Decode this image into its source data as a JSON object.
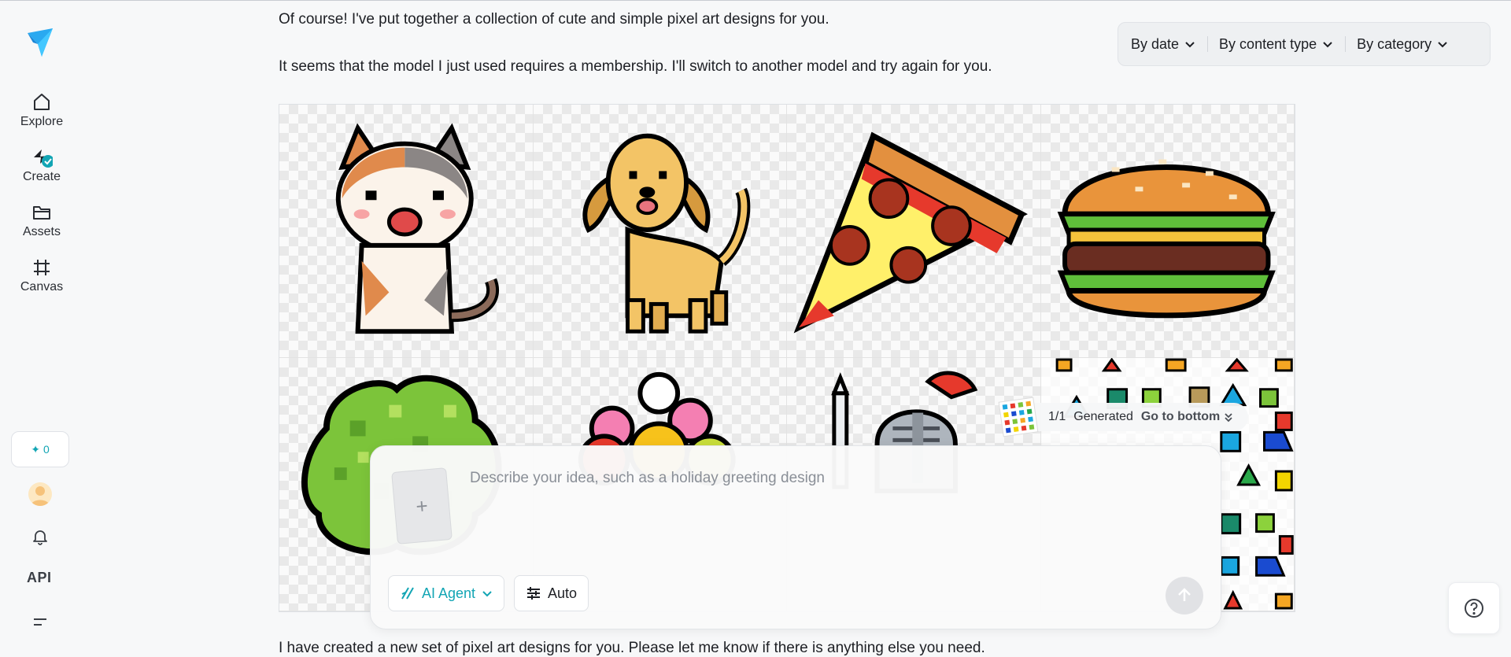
{
  "nav": {
    "items": [
      {
        "label": "Explore",
        "icon": "home-icon"
      },
      {
        "label": "Create",
        "icon": "create-icon"
      },
      {
        "label": "Assets",
        "icon": "folder-icon"
      },
      {
        "label": "Canvas",
        "icon": "canvas-frame-icon"
      }
    ],
    "credits": "0",
    "api_label": "API"
  },
  "messages": {
    "first": "Of course! I've put together a collection of cute and simple pixel art designs for you.",
    "second": "It seems that the model I just used requires a membership. I'll switch to another model and try again for you.",
    "final": "I have created a new set of pixel art designs for you. Please let me know if there is anything else you need."
  },
  "filters": {
    "date": "By date",
    "content_type": "By content type",
    "category": "By category"
  },
  "grid": {
    "tiles": [
      "cat",
      "dog",
      "pizza",
      "burger",
      "bush",
      "flower",
      "knight",
      "shapes"
    ]
  },
  "generation": {
    "count": "1/1",
    "status": "Generated",
    "go_bottom": "Go to bottom"
  },
  "prompt": {
    "placeholder": "Describe your idea, such as a holiday greeting design",
    "upload_icon": "+",
    "agent_label": "AI Agent",
    "auto_label": "Auto"
  },
  "colors": {
    "accent": "#12a5b4",
    "text": "#1d1f24",
    "background": "#f7f8f9"
  }
}
